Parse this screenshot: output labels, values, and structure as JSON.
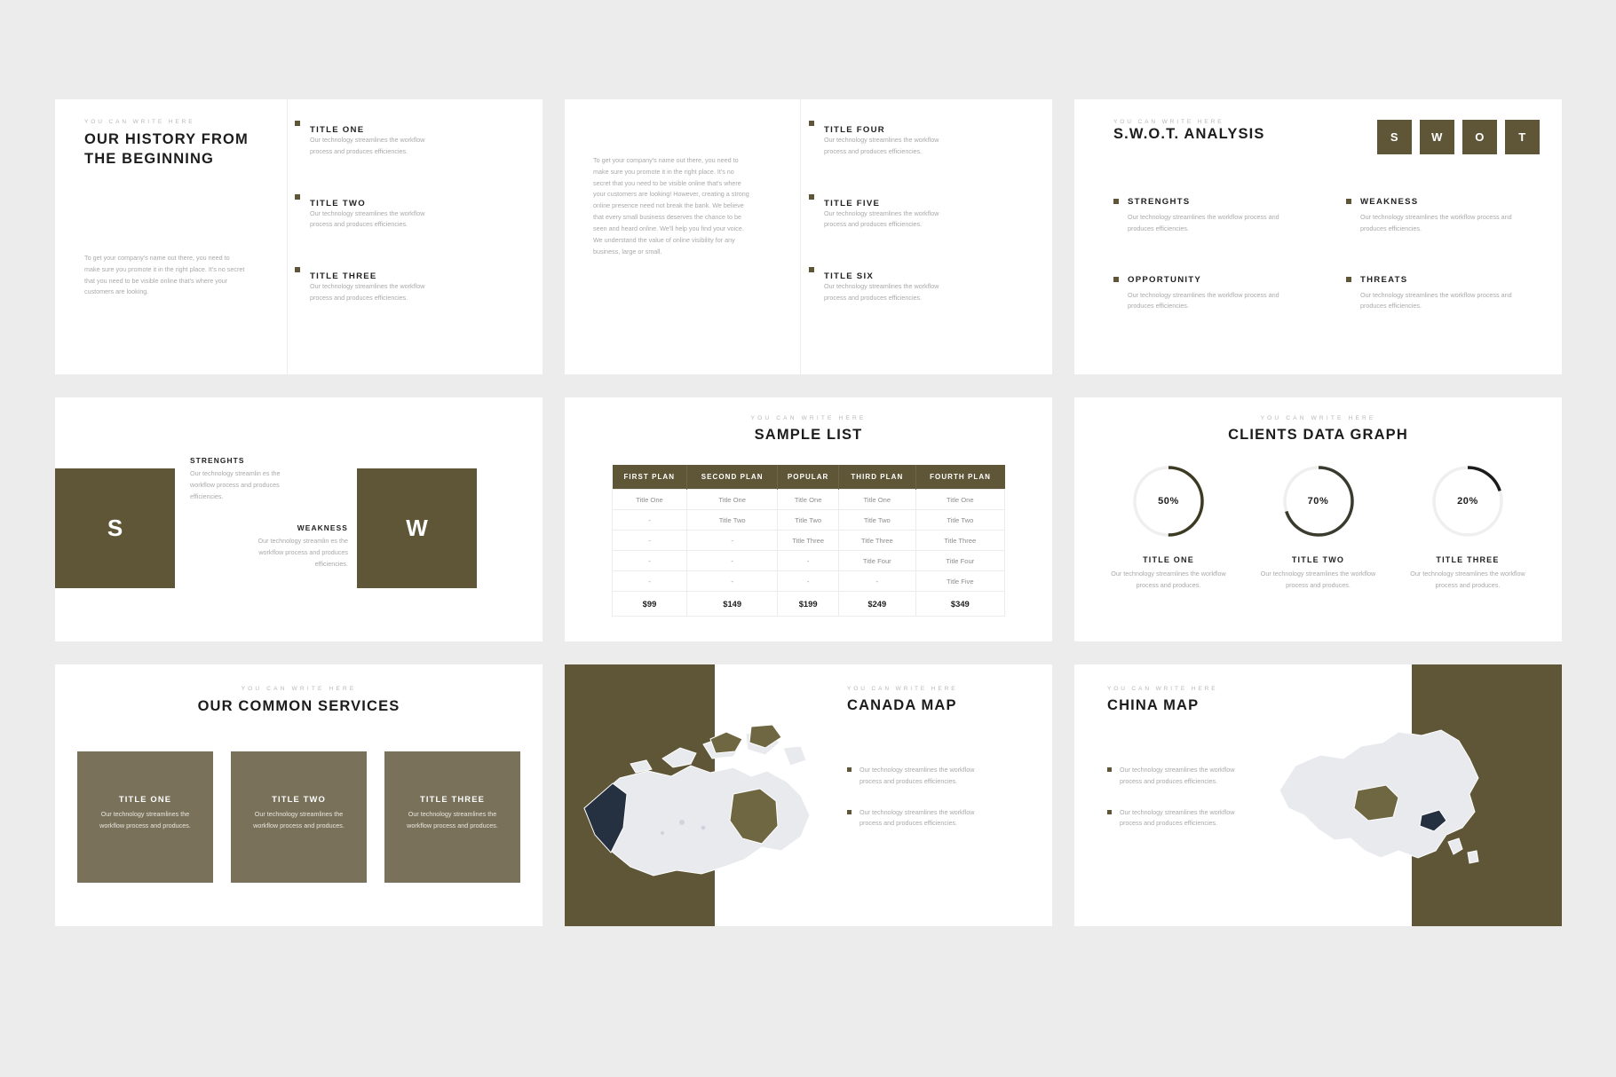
{
  "theme": {
    "accent": "#5e5636",
    "accent_light": "#79715a",
    "page_bg": "#ececec",
    "slide_bg": "#ffffff",
    "body_text": "#a9a9a9",
    "heading_text": "#1c1c1c"
  },
  "common": {
    "eyebrow": "YOU CAN WRITE HERE",
    "body": "Our technology streamlines the workflow process and produces efficiencies.",
    "body_short": "Our technology streamlines the workflow process and produces.",
    "body_wrap": "Our technology streamlin es the workflow process and produces efficiencies."
  },
  "slide_history": {
    "eyebrow": "YOU CAN WRITE HERE",
    "title": "OUR HISTORY FROM THE BEGINNING",
    "paragraph": "To get your company's name out there, you need to make sure you promote it in the right place. It's no secret that you need to be visible online that's where your customers are looking.",
    "features": [
      {
        "title": "TITLE ONE",
        "body": "Our technology streamlines the workflow process and produces efficiencies."
      },
      {
        "title": "TITLE TWO",
        "body": "Our technology streamlines the workflow process and produces efficiencies."
      },
      {
        "title": "TITLE THREE",
        "body": "Our technology streamlines the workflow process and produces efficiencies."
      }
    ]
  },
  "slide_continued": {
    "paragraph": "To get your company's name out there, you need to make sure you promote it in the right place. It's no secret that you need to be visible online that's where your customers are looking! However, creating a strong online presence need not break the bank. We believe that every small business deserves the chance to be seen and heard online. We'll help you find your voice. We understand the value of online visibility for any business, large or small.",
    "features": [
      {
        "title": "TITLE FOUR",
        "body": "Our technology streamlines the workflow process and produces efficiencies."
      },
      {
        "title": "TITLE FIVE",
        "body": "Our technology streamlines the workflow process and produces efficiencies."
      },
      {
        "title": "TITLE SIX",
        "body": "Our technology streamlines the workflow process and produces efficiencies."
      }
    ]
  },
  "slide_swot": {
    "eyebrow": "YOU CAN WRITE HERE",
    "title": "S.W.O.T. ANALYSIS",
    "letters": [
      "S",
      "W",
      "O",
      "T"
    ],
    "cells": [
      {
        "title": "STRENGHTS",
        "body": "Our technology streamlines the workflow process and produces efficiencies."
      },
      {
        "title": "WEAKNESS",
        "body": "Our technology streamlines the workflow process and produces efficiencies."
      },
      {
        "title": "OPPORTUNITY",
        "body": "Our technology streamlines the workflow process and produces efficiencies."
      },
      {
        "title": "THREATS",
        "body": "Our technology streamlines the workflow process and produces efficiencies."
      }
    ]
  },
  "slide_sw": {
    "block_s": "S",
    "block_w": "W",
    "strengths": {
      "title": "STRENGHTS",
      "body": "Our technology streamlin es the workflow process and produces efficiencies."
    },
    "weakness": {
      "title": "WEAKNESS",
      "body": "Our technology streamlin es the workflow process and produces efficiencies."
    }
  },
  "slide_sample_list": {
    "eyebrow": "YOU CAN WRITE HERE",
    "title": "SAMPLE LIST",
    "chart_data": {
      "type": "table",
      "title": "SAMPLE LIST",
      "columns": [
        "FIRST PLAN",
        "SECOND PLAN",
        "POPULAR",
        "THIRD PLAN",
        "FOURTH PLAN"
      ],
      "rows": [
        [
          "Title One",
          "Title One",
          "Title One",
          "Title One",
          "Title One"
        ],
        [
          "-",
          "Title Two",
          "Title Two",
          "Title Two",
          "Title Two"
        ],
        [
          "-",
          "-",
          "Title Three",
          "Title Three",
          "Title Three"
        ],
        [
          "-",
          "-",
          "-",
          "Title Four",
          "Title Four"
        ],
        [
          "-",
          "-",
          "-",
          "-",
          "Title Five"
        ],
        [
          "$99",
          "$149",
          "$199",
          "$249",
          "$349"
        ]
      ],
      "price_row_index": 5
    }
  },
  "slide_clients": {
    "eyebrow": "YOU CAN WRITE HERE",
    "title": "CLIENTS DATA GRAPH",
    "chart_data": {
      "type": "pie",
      "title": "CLIENTS DATA GRAPH",
      "subtype": "donut-gauge",
      "track_color": "#efefef",
      "ring_colors": [
        "#3d3a23",
        "#3b3a2f",
        "#1c1c1c"
      ],
      "categories": [
        "TITLE ONE",
        "TITLE TWO",
        "TITLE THREE"
      ],
      "values": [
        50,
        70,
        20
      ],
      "value_labels": [
        "50%",
        "70%",
        "20%"
      ],
      "ylim": [
        0,
        100
      ]
    },
    "donuts": [
      {
        "label": "50%",
        "value": 50,
        "title": "TITLE ONE",
        "body": "Our technology streamlines the workflow process and produces.",
        "color": "#3d3a23"
      },
      {
        "label": "70%",
        "value": 70,
        "title": "TITLE TWO",
        "body": "Our technology streamlines the workflow process and produces.",
        "color": "#3b3a2f"
      },
      {
        "label": "20%",
        "value": 20,
        "title": "TITLE THREE",
        "body": "Our technology streamlines the workflow process and produces.",
        "color": "#1c1c1c"
      }
    ]
  },
  "slide_services": {
    "eyebrow": "YOU CAN WRITE HERE",
    "title": "OUR COMMON SERVICES",
    "cards": [
      {
        "title": "TITLE ONE",
        "body": "Our technology streamlines the workflow process and produces."
      },
      {
        "title": "TITLE TWO",
        "body": "Our technology streamlines the workflow process and produces."
      },
      {
        "title": "TITLE THREE",
        "body": "Our technology streamlines the workflow process and produces."
      }
    ]
  },
  "slide_canada": {
    "eyebrow": "YOU CAN WRITE HERE",
    "title": "CANADA MAP",
    "map_name": "canada-map",
    "items": [
      {
        "body": "Our technology streamlines the workflow process and produces efficiencies."
      },
      {
        "body": "Our technology streamlines the workflow process and produces efficiencies."
      }
    ]
  },
  "slide_china": {
    "eyebrow": "YOU CAN WRITE HERE",
    "title": "CHINA MAP",
    "map_name": "china-map",
    "items": [
      {
        "body": "Our technology streamlines the workflow process and produces efficiencies."
      },
      {
        "body": "Our technology streamlines the workflow process and produces efficiencies."
      }
    ]
  }
}
